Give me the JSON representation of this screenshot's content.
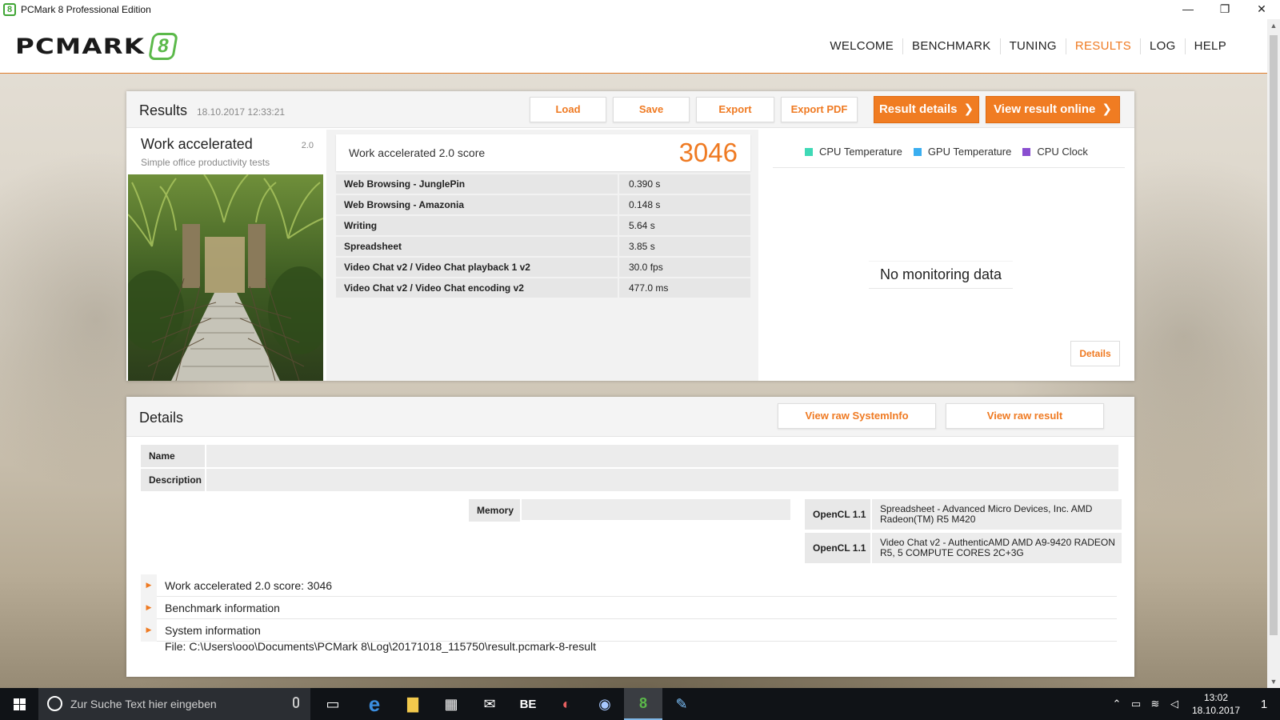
{
  "window": {
    "title": "PCMark 8 Professional Edition",
    "badge": "8",
    "controls": {
      "minimize": "—",
      "maximize": "❐",
      "close": "✕"
    }
  },
  "header": {
    "logo_text": "PCMARK",
    "logo_num": "8",
    "nav": [
      {
        "label": "WELCOME",
        "active": false
      },
      {
        "label": "BENCHMARK",
        "active": false
      },
      {
        "label": "TUNING",
        "active": false
      },
      {
        "label": "RESULTS",
        "active": true
      },
      {
        "label": "LOG",
        "active": false
      },
      {
        "label": "HELP",
        "active": false
      }
    ]
  },
  "results": {
    "title": "Results",
    "date": "18.10.2017 12:33:21",
    "buttons": {
      "load": "Load",
      "save": "Save",
      "export": "Export",
      "export_pdf": "Export PDF",
      "result_details": "Result details",
      "view_online": "View result online"
    },
    "test": {
      "name": "Work accelerated",
      "version": "2.0",
      "subtitle": "Simple office productivity tests"
    },
    "score": {
      "label": "Work accelerated 2.0 score",
      "value": "3046"
    },
    "subtests": [
      {
        "name": "Web Browsing - JunglePin",
        "value": "0.390 s"
      },
      {
        "name": "Web Browsing - Amazonia",
        "value": "0.148 s"
      },
      {
        "name": "Writing",
        "value": "5.64 s"
      },
      {
        "name": "Spreadsheet",
        "value": "3.85 s"
      },
      {
        "name": "Video Chat v2 / Video Chat playback 1 v2",
        "value": "30.0 fps"
      },
      {
        "name": "Video Chat v2 / Video Chat encoding v2",
        "value": "477.0 ms"
      }
    ],
    "monitoring": {
      "legend": [
        {
          "label": "CPU Temperature",
          "color": "#3fd9b6"
        },
        {
          "label": "GPU Temperature",
          "color": "#3aaef0"
        },
        {
          "label": "CPU Clock",
          "color": "#8a4fd0"
        }
      ],
      "empty_text": "No monitoring data",
      "details_button": "Details"
    }
  },
  "details": {
    "title": "Details",
    "buttons": {
      "raw_systeminfo": "View raw SystemInfo",
      "raw_result": "View raw result"
    },
    "fields": {
      "name_key": "Name",
      "name_value": "",
      "description_key": "Description",
      "description_value": "",
      "memory_key": "Memory",
      "memory_value": ""
    },
    "opencl": [
      {
        "key": "OpenCL 1.1",
        "value": "Spreadsheet - Advanced Micro Devices, Inc. AMD Radeon(TM) R5 M420"
      },
      {
        "key": "OpenCL 1.1",
        "value": "Video Chat v2 - AuthenticAMD AMD A9-9420 RADEON R5, 5 COMPUTE CORES 2C+3G"
      }
    ],
    "expanders": [
      {
        "label": "Work accelerated 2.0 score: 3046"
      },
      {
        "label": "Benchmark information"
      },
      {
        "label": "System information"
      }
    ],
    "file": "File: C:\\Users\\ooo\\Documents\\PCMark 8\\Log\\20171018_115750\\result.pcmark-8-result"
  },
  "taskbar": {
    "search_placeholder": "Zur Suche Text hier eingeben",
    "apps": [
      {
        "name": "task-view",
        "glyph": "▭"
      },
      {
        "name": "edge",
        "glyph": "e"
      },
      {
        "name": "file-explorer",
        "glyph": "▇"
      },
      {
        "name": "store",
        "glyph": "▦"
      },
      {
        "name": "mail",
        "glyph": "✉"
      },
      {
        "name": "be-app",
        "glyph": "BE"
      },
      {
        "name": "paint-app",
        "glyph": "◐"
      },
      {
        "name": "vpn-app",
        "glyph": "◉"
      },
      {
        "name": "pcmark",
        "glyph": "8"
      },
      {
        "name": "paint-brush-app",
        "glyph": "✎"
      }
    ],
    "time": "13:02",
    "date": "18.10.2017",
    "notifications": "1"
  }
}
